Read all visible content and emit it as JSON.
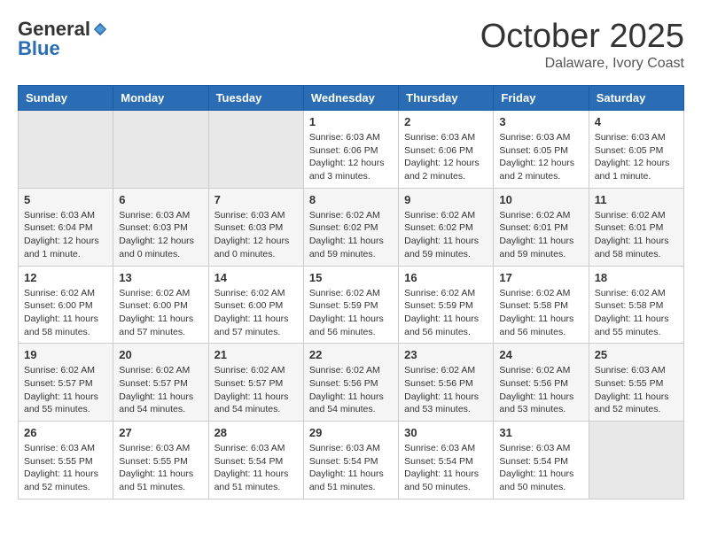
{
  "header": {
    "logo": {
      "general": "General",
      "blue": "Blue"
    },
    "title": "October 2025",
    "location": "Dalaware, Ivory Coast"
  },
  "days_of_week": [
    "Sunday",
    "Monday",
    "Tuesday",
    "Wednesday",
    "Thursday",
    "Friday",
    "Saturday"
  ],
  "weeks": [
    [
      {
        "day": "",
        "info": ""
      },
      {
        "day": "",
        "info": ""
      },
      {
        "day": "",
        "info": ""
      },
      {
        "day": "1",
        "info": "Sunrise: 6:03 AM\nSunset: 6:06 PM\nDaylight: 12 hours and 3 minutes."
      },
      {
        "day": "2",
        "info": "Sunrise: 6:03 AM\nSunset: 6:06 PM\nDaylight: 12 hours and 2 minutes."
      },
      {
        "day": "3",
        "info": "Sunrise: 6:03 AM\nSunset: 6:05 PM\nDaylight: 12 hours and 2 minutes."
      },
      {
        "day": "4",
        "info": "Sunrise: 6:03 AM\nSunset: 6:05 PM\nDaylight: 12 hours and 1 minute."
      }
    ],
    [
      {
        "day": "5",
        "info": "Sunrise: 6:03 AM\nSunset: 6:04 PM\nDaylight: 12 hours and 1 minute."
      },
      {
        "day": "6",
        "info": "Sunrise: 6:03 AM\nSunset: 6:03 PM\nDaylight: 12 hours and 0 minutes."
      },
      {
        "day": "7",
        "info": "Sunrise: 6:03 AM\nSunset: 6:03 PM\nDaylight: 12 hours and 0 minutes."
      },
      {
        "day": "8",
        "info": "Sunrise: 6:02 AM\nSunset: 6:02 PM\nDaylight: 11 hours and 59 minutes."
      },
      {
        "day": "9",
        "info": "Sunrise: 6:02 AM\nSunset: 6:02 PM\nDaylight: 11 hours and 59 minutes."
      },
      {
        "day": "10",
        "info": "Sunrise: 6:02 AM\nSunset: 6:01 PM\nDaylight: 11 hours and 59 minutes."
      },
      {
        "day": "11",
        "info": "Sunrise: 6:02 AM\nSunset: 6:01 PM\nDaylight: 11 hours and 58 minutes."
      }
    ],
    [
      {
        "day": "12",
        "info": "Sunrise: 6:02 AM\nSunset: 6:00 PM\nDaylight: 11 hours and 58 minutes."
      },
      {
        "day": "13",
        "info": "Sunrise: 6:02 AM\nSunset: 6:00 PM\nDaylight: 11 hours and 57 minutes."
      },
      {
        "day": "14",
        "info": "Sunrise: 6:02 AM\nSunset: 6:00 PM\nDaylight: 11 hours and 57 minutes."
      },
      {
        "day": "15",
        "info": "Sunrise: 6:02 AM\nSunset: 5:59 PM\nDaylight: 11 hours and 56 minutes."
      },
      {
        "day": "16",
        "info": "Sunrise: 6:02 AM\nSunset: 5:59 PM\nDaylight: 11 hours and 56 minutes."
      },
      {
        "day": "17",
        "info": "Sunrise: 6:02 AM\nSunset: 5:58 PM\nDaylight: 11 hours and 56 minutes."
      },
      {
        "day": "18",
        "info": "Sunrise: 6:02 AM\nSunset: 5:58 PM\nDaylight: 11 hours and 55 minutes."
      }
    ],
    [
      {
        "day": "19",
        "info": "Sunrise: 6:02 AM\nSunset: 5:57 PM\nDaylight: 11 hours and 55 minutes."
      },
      {
        "day": "20",
        "info": "Sunrise: 6:02 AM\nSunset: 5:57 PM\nDaylight: 11 hours and 54 minutes."
      },
      {
        "day": "21",
        "info": "Sunrise: 6:02 AM\nSunset: 5:57 PM\nDaylight: 11 hours and 54 minutes."
      },
      {
        "day": "22",
        "info": "Sunrise: 6:02 AM\nSunset: 5:56 PM\nDaylight: 11 hours and 54 minutes."
      },
      {
        "day": "23",
        "info": "Sunrise: 6:02 AM\nSunset: 5:56 PM\nDaylight: 11 hours and 53 minutes."
      },
      {
        "day": "24",
        "info": "Sunrise: 6:02 AM\nSunset: 5:56 PM\nDaylight: 11 hours and 53 minutes."
      },
      {
        "day": "25",
        "info": "Sunrise: 6:03 AM\nSunset: 5:55 PM\nDaylight: 11 hours and 52 minutes."
      }
    ],
    [
      {
        "day": "26",
        "info": "Sunrise: 6:03 AM\nSunset: 5:55 PM\nDaylight: 11 hours and 52 minutes."
      },
      {
        "day": "27",
        "info": "Sunrise: 6:03 AM\nSunset: 5:55 PM\nDaylight: 11 hours and 51 minutes."
      },
      {
        "day": "28",
        "info": "Sunrise: 6:03 AM\nSunset: 5:54 PM\nDaylight: 11 hours and 51 minutes."
      },
      {
        "day": "29",
        "info": "Sunrise: 6:03 AM\nSunset: 5:54 PM\nDaylight: 11 hours and 51 minutes."
      },
      {
        "day": "30",
        "info": "Sunrise: 6:03 AM\nSunset: 5:54 PM\nDaylight: 11 hours and 50 minutes."
      },
      {
        "day": "31",
        "info": "Sunrise: 6:03 AM\nSunset: 5:54 PM\nDaylight: 11 hours and 50 minutes."
      },
      {
        "day": "",
        "info": ""
      }
    ]
  ]
}
